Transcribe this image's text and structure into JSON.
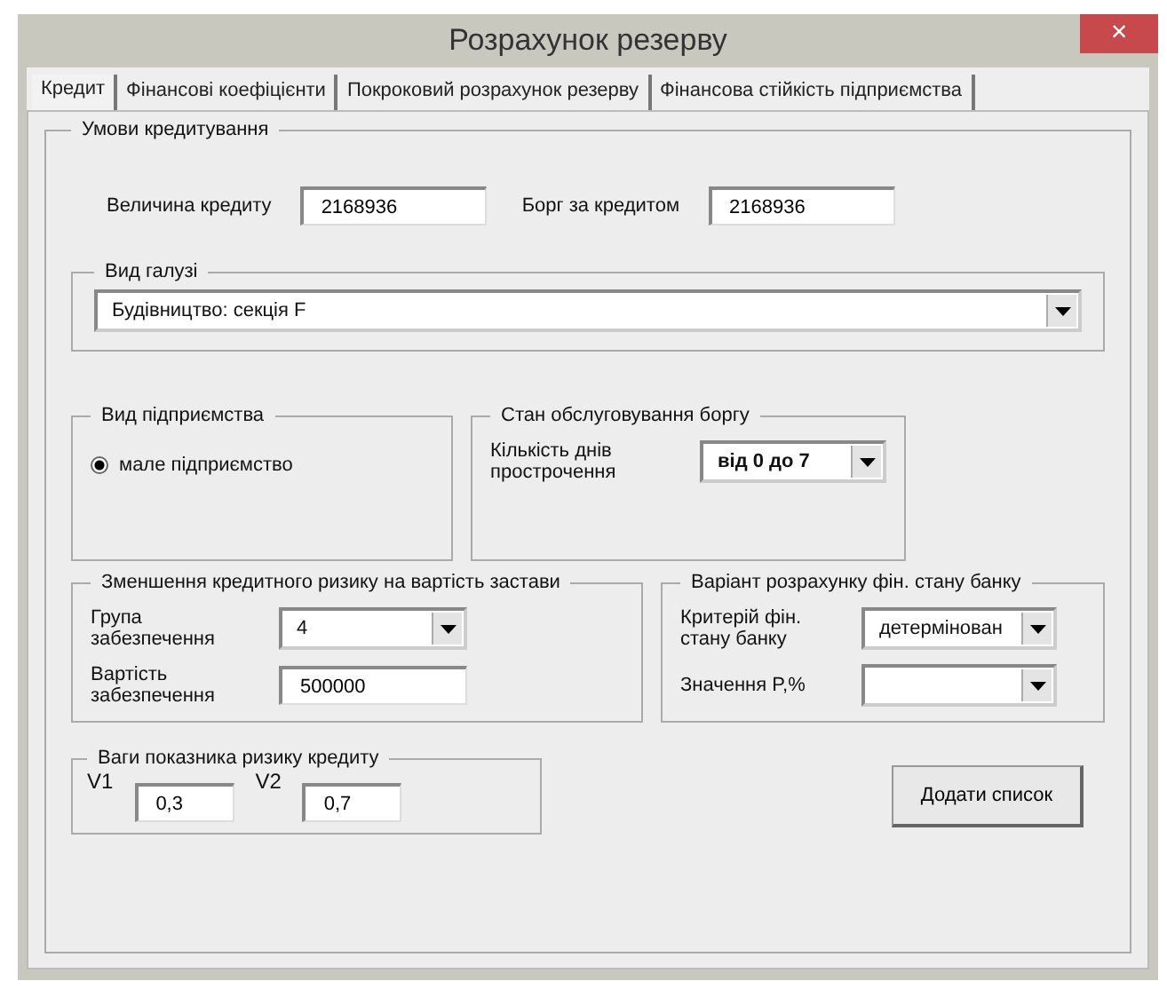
{
  "window": {
    "title": "Розрахунок резерву",
    "close": "×"
  },
  "tabs": [
    {
      "label": "Кредит",
      "selected": true
    },
    {
      "label": "Фінансові коефіцієнти",
      "selected": false
    },
    {
      "label": "Покроковий розрахунок резерву",
      "selected": false
    },
    {
      "label": "Фінансова стійкість підприємства",
      "selected": false
    }
  ],
  "credit_terms": {
    "legend": "Умови кредитування",
    "credit_amount": {
      "label": "Величина кредиту",
      "value": "2168936"
    },
    "debt": {
      "label": "Борг за кредитом",
      "value": "2168936"
    },
    "industry": {
      "legend": "Вид галузі",
      "value": "Будівництво: секція F"
    },
    "enterprise": {
      "legend": "Вид підприємства",
      "options": [
        {
          "label": "мале підприємство",
          "selected": true
        }
      ]
    },
    "debt_service": {
      "legend": "Стан обслуговування боргу",
      "label": "Кількість днів прострочення",
      "value": "від 0 до 7"
    },
    "collateral": {
      "legend": "Зменшення кредитного ризику на вартість застави",
      "group": {
        "label": "Група забезпечення",
        "value": "4"
      },
      "cost": {
        "label": "Вартість забезпечення",
        "value": "500000"
      }
    },
    "bank": {
      "legend": "Варіант розрахунку фін. стану банку",
      "criterion": {
        "label": "Критерій фін. стану банку",
        "value": "детермінован"
      },
      "p_value": {
        "label": "Значення P,%"
      }
    },
    "weights": {
      "legend": "Ваги показника ризику кредиту",
      "v1": {
        "label": "V1",
        "value": "0,3"
      },
      "v2": {
        "label": "V2",
        "value": "0,7"
      }
    },
    "add_button": "Додати список"
  }
}
